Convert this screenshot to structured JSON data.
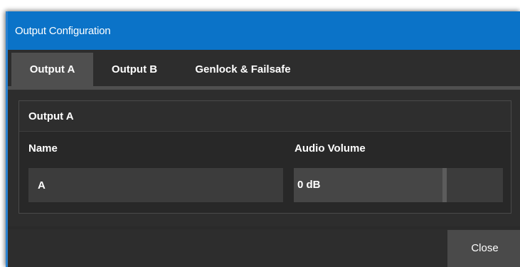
{
  "window": {
    "title": "Output Configuration"
  },
  "tabs": [
    {
      "label": "Output A",
      "active": true
    },
    {
      "label": "Output B",
      "active": false
    },
    {
      "label": "Genlock & Failsafe",
      "active": false
    }
  ],
  "group": {
    "title": "Output A",
    "name_label": "Name",
    "name_value": "A",
    "audio_label": "Audio Volume",
    "audio_value": "0 dB",
    "audio_level_fraction": 0.72
  },
  "footer": {
    "close_label": "Close"
  },
  "colors": {
    "titlebar": "#0b73c8",
    "accent_border": "#2a82d0",
    "background": "#2d2d2d",
    "active_tab": "#4f4f4f"
  }
}
